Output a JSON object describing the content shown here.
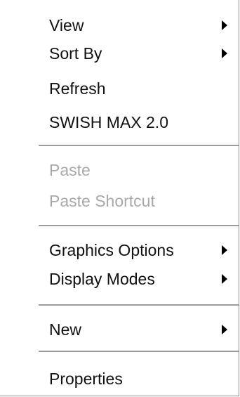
{
  "menu": {
    "items": [
      {
        "label": "View",
        "submenu": true,
        "enabled": true
      },
      {
        "label": "Sort By",
        "submenu": true,
        "enabled": true
      },
      {
        "label": "Refresh",
        "submenu": false,
        "enabled": true
      },
      {
        "label": "SWISH MAX 2.0",
        "submenu": false,
        "enabled": true
      },
      {
        "label": "Paste",
        "submenu": false,
        "enabled": false
      },
      {
        "label": "Paste Shortcut",
        "submenu": false,
        "enabled": false
      },
      {
        "label": "Graphics Options",
        "submenu": true,
        "enabled": true
      },
      {
        "label": "Display Modes",
        "submenu": true,
        "enabled": true
      },
      {
        "label": "New",
        "submenu": true,
        "enabled": true
      },
      {
        "label": "Properties",
        "submenu": false,
        "enabled": true
      }
    ]
  },
  "colors": {
    "text": "#111111",
    "disabled_text": "#a9a9a9",
    "separator": "#9c9c9c",
    "background": "#ffffff"
  }
}
